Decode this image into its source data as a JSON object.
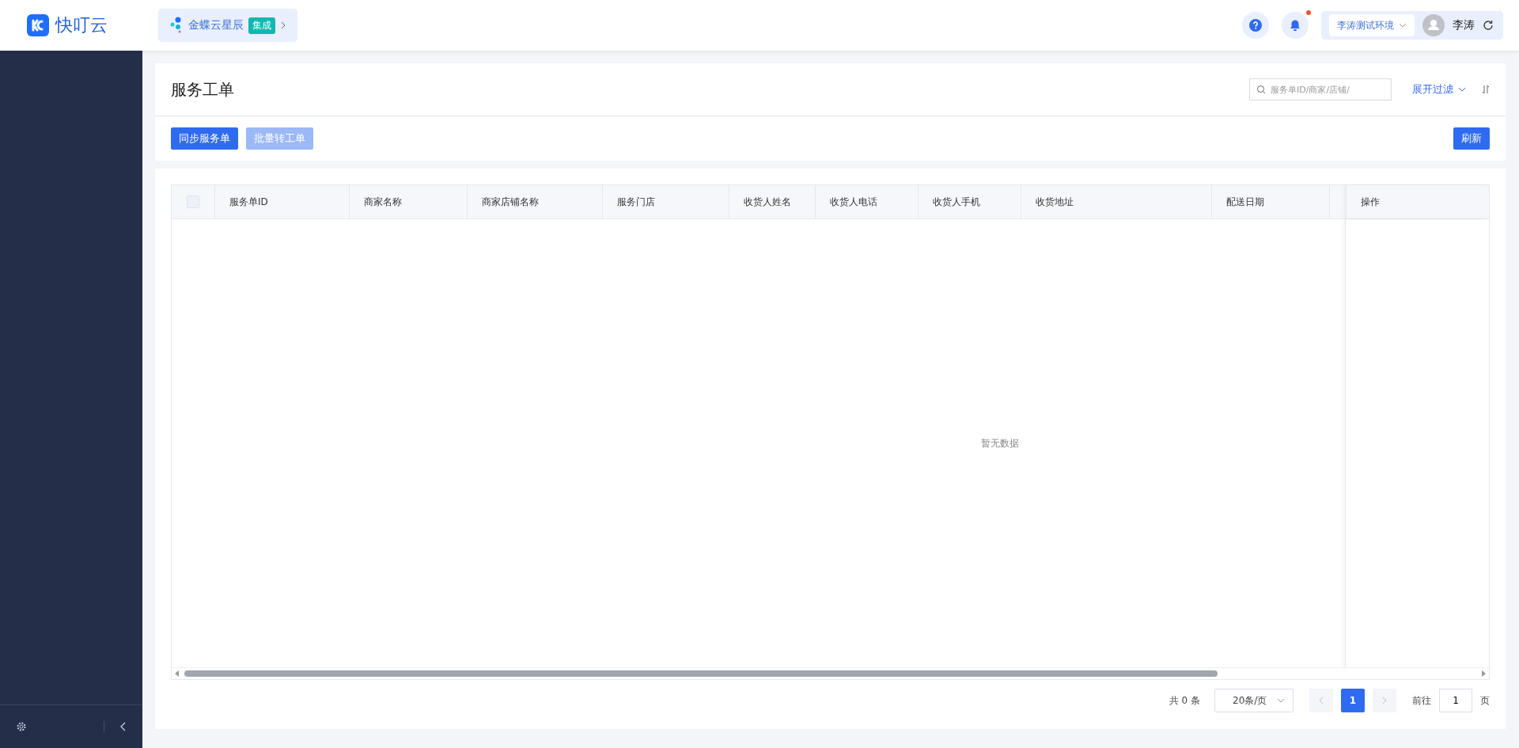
{
  "brand": {
    "name": "快叮云"
  },
  "integration": {
    "name": "金蝶云星辰",
    "badge": "集成"
  },
  "topbar": {
    "notification_dot": true,
    "environment": "李涛测试环境",
    "user": "李涛"
  },
  "page": {
    "title": "服务工单",
    "search": {
      "placeholder": "服务单ID/商家/店铺/"
    },
    "filter_toggle": "展开过滤"
  },
  "toolbar": {
    "buttons": [
      {
        "label": "同步服务单",
        "disabled": false
      },
      {
        "label": "批量转工单",
        "disabled": true
      }
    ],
    "refresh": "刷新"
  },
  "table": {
    "select_all": {
      "checked": false
    },
    "columns": [
      {
        "label": "服务单ID"
      },
      {
        "label": "商家名称"
      },
      {
        "label": "商家店铺名称"
      },
      {
        "label": "服务门店"
      },
      {
        "label": "收货人姓名"
      },
      {
        "label": "收货人电话"
      },
      {
        "label": "收货人手机"
      },
      {
        "label": "收货地址"
      },
      {
        "label": "配送日期"
      }
    ],
    "action_column": "操作",
    "empty_text": "暂无数据"
  },
  "pagination": {
    "total": "共 0 条",
    "page_size": "20条/页",
    "pages": [
      {
        "label": "1",
        "selected": true
      }
    ],
    "goto_label": "前往",
    "goto_value": "1",
    "page_suffix": "页"
  }
}
